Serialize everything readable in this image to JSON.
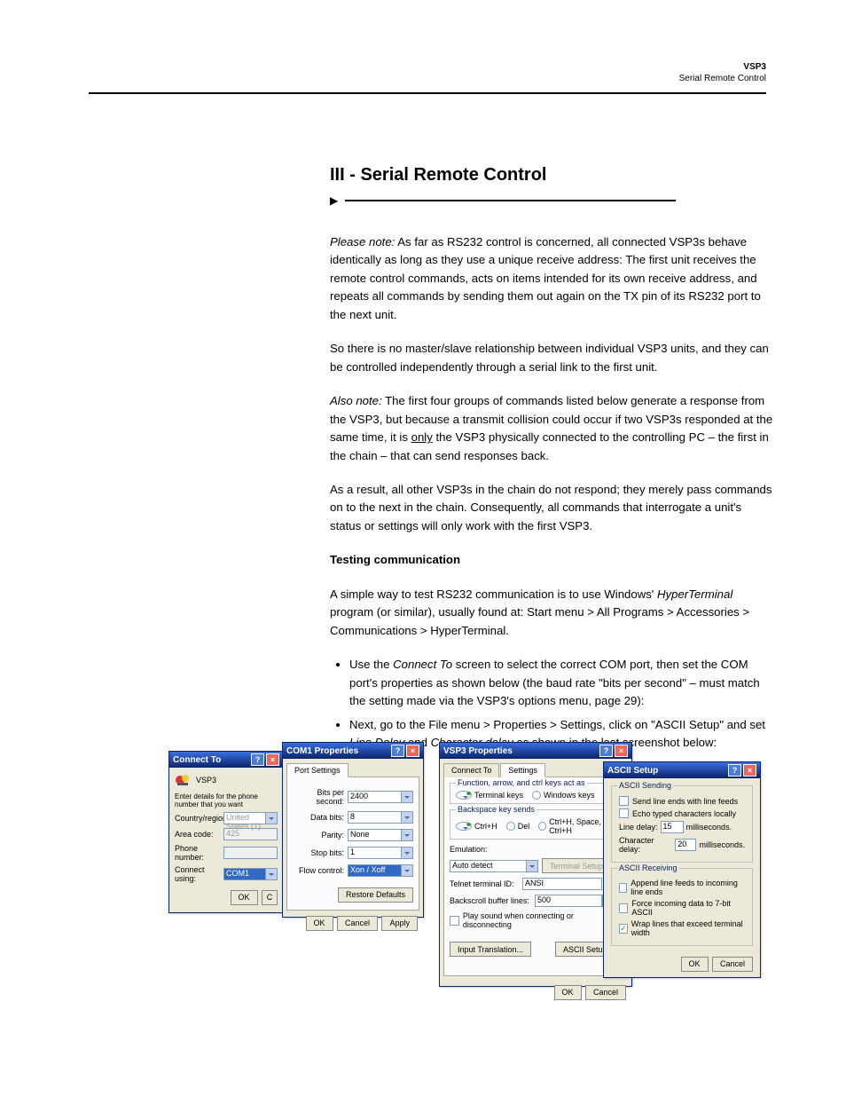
{
  "header": {
    "product": "VSP3",
    "subtitle": "Serial Remote Control",
    "section_title": "III - Serial Remote Control"
  },
  "body": {
    "n1_lead": "Please note:",
    "n1_rest": " As far as RS232 control is concerned, all connected VSP3s behave identically as long as they use a unique receive address: The first unit receives the remote control commands, acts on items intended for its own receive address, and repeats all commands by sending them out again on the TX pin of its RS232 port to the next unit.",
    "p2": "So there is no master/slave relationship between individual VSP3 units, and they can be controlled independently through a serial link to the first unit.",
    "n2_lead": "Also note:",
    "n2_rest": " The first four groups of commands listed below generate a response from the VSP3, but because a transmit collision could occur if two VSP3s responded at the same time, it is ",
    "n2_u": "only",
    "n2_rest2": " the VSP3 physically connected to the controlling PC – the first in the chain – that can send responses back.",
    "p4": "As a result, all other VSP3s in the chain do not respond; they merely pass commands on to the next in the chain. Consequently, all commands that interrogate a unit's status or settings will only work with the first VSP3.",
    "h_testing": "Testing communication",
    "p5": "A simple way to test RS232 communication is to use Windows' ",
    "p5_i": "HyperTerminal",
    "p5_rest": " program (or similar), usually found at: Start menu > All Programs > Accessories > Communications > HyperTerminal.",
    "li1_a": "Use the ",
    "li1_b": "Connect To",
    "li1_c": " screen to select the correct COM port, then set the COM port's properties as shown below (the baud rate \"bits per second\" – must match the setting made via the VSP3's options menu, page 29):",
    "li2_a": "Next, go to the File menu > Properties > Settings, click on \"ASCII Setup\" and set ",
    "li2_b": "Line Delay",
    "li2_c": " and ",
    "li2_d": "Character delay",
    "li2_e": " as shown in the last screenshot below:"
  },
  "dlg1": {
    "title": "Connect To",
    "name": "VSP3",
    "hint": "Enter details for the phone number that you want",
    "f_country": "Country/region:",
    "v_country": "United States (1)",
    "f_area": "Area code:",
    "v_area": "425",
    "f_phone": "Phone number:",
    "f_using": "Connect using:",
    "v_using": "COM1",
    "ok": "OK",
    "cancel": "C"
  },
  "dlg2": {
    "title": "COM1 Properties",
    "tab": "Port Settings",
    "f_baud": "Bits per second:",
    "v_baud": "2400",
    "f_data": "Data bits:",
    "v_data": "8",
    "f_parity": "Parity:",
    "v_parity": "None",
    "f_stop": "Stop bits:",
    "v_stop": "1",
    "f_flow": "Flow control:",
    "v_flow": "Xon / Xoff",
    "restore": "Restore Defaults",
    "ok": "OK",
    "cancel": "Cancel",
    "apply": "Apply"
  },
  "dlg3": {
    "title": "VSP3 Properties",
    "tab1": "Connect To",
    "tab2": "Settings",
    "g1": "Function, arrow, and ctrl keys act as",
    "r1a": "Terminal keys",
    "r1b": "Windows keys",
    "g2": "Backspace key sends",
    "r2a": "Ctrl+H",
    "r2b": "Del",
    "r2c": "Ctrl+H, Space, Ctrl+H",
    "f_emul": "Emulation:",
    "v_emul": "Auto detect",
    "b_term": "Terminal Setup...",
    "f_telnet": "Telnet terminal ID:",
    "v_telnet": "ANSI",
    "f_back": "Backscroll buffer lines:",
    "v_back": "500",
    "chk_beep": "Play sound when connecting or disconnecting",
    "b_input": "Input Translation...",
    "b_ascii": "ASCII Setup...",
    "ok": "OK",
    "cancel": "Cancel"
  },
  "dlg4": {
    "title": "ASCII Setup",
    "g1": "ASCII Sending",
    "c1": "Send line ends with line feeds",
    "c2": "Echo typed characters locally",
    "f_line": "Line delay:",
    "v_line": "15",
    "u_line": "milliseconds.",
    "f_char": "Character delay:",
    "v_char": "20",
    "u_char": "milliseconds.",
    "g2": "ASCII Receiving",
    "c3": "Append line feeds to incoming line ends",
    "c4": "Force incoming data to 7-bit ASCII",
    "c5": "Wrap lines that exceed terminal width",
    "ok": "OK",
    "cancel": "Cancel"
  }
}
